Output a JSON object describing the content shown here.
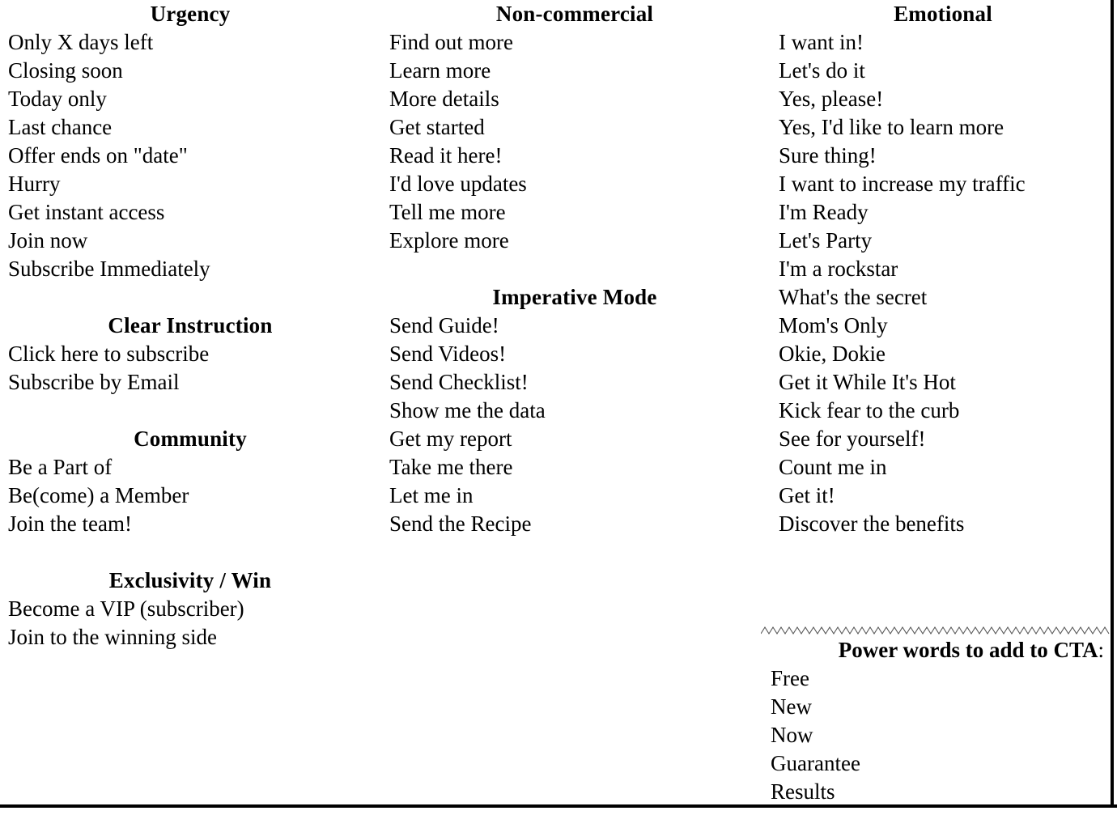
{
  "page": {
    "background_color": "#ffffff",
    "text_color": "#000000",
    "border_color": "#000000"
  },
  "columns": [
    {
      "name": "column-left",
      "sections": [
        {
          "heading": "Urgency",
          "items": [
            "Only X days left",
            "Closing soon",
            "Today only",
            "Last chance",
            "Offer ends on \"date\"",
            "Hurry",
            "Get instant access",
            "Join now",
            "Subscribe Immediately"
          ]
        },
        {
          "heading": "Clear Instruction",
          "items": [
            "Click here to subscribe",
            "Subscribe by Email"
          ]
        },
        {
          "heading": "Community",
          "items": [
            "Be a Part of",
            "Be(come) a Member",
            "Join the team!"
          ]
        },
        {
          "heading": "Exclusivity / Win",
          "items": [
            "Become a VIP (subscriber)",
            "Join to the winning side"
          ]
        }
      ]
    },
    {
      "name": "column-middle",
      "sections": [
        {
          "heading": "Non-commercial",
          "items": [
            "Find out more",
            "Learn more",
            "More details",
            "Get started",
            "Read it here!",
            "I'd love updates",
            "Tell me more",
            "Explore more"
          ]
        },
        {
          "heading": "Imperative Mode",
          "items": [
            "Send Guide!",
            "Send Videos!",
            "Send Checklist!",
            "Show me the data",
            "Get my report",
            "Take me there",
            "Let me in",
            "Send the Recipe"
          ]
        }
      ]
    },
    {
      "name": "column-right",
      "sections": [
        {
          "heading": "Emotional",
          "items": [
            "I want in!",
            "Let's do it",
            "Yes, please!",
            "Yes, I'd like to learn more",
            "Sure thing!",
            "I want to increase my traffic",
            "I'm Ready",
            "Let's Party",
            "I'm a rockstar",
            "What's the secret",
            "Mom's Only",
            "Okie, Dokie",
            "Get it While It's Hot",
            "Kick fear to the curb",
            "See for yourself!",
            "Count me in",
            "Get it!",
            "Discover the benefits"
          ]
        }
      ]
    }
  ],
  "power_words": {
    "separator": "zigzag-rule",
    "heading": "Power words to add to CTA",
    "heading_colon": ":",
    "items": [
      "Free",
      "New",
      "Now",
      "Guarantee",
      "Results"
    ]
  }
}
